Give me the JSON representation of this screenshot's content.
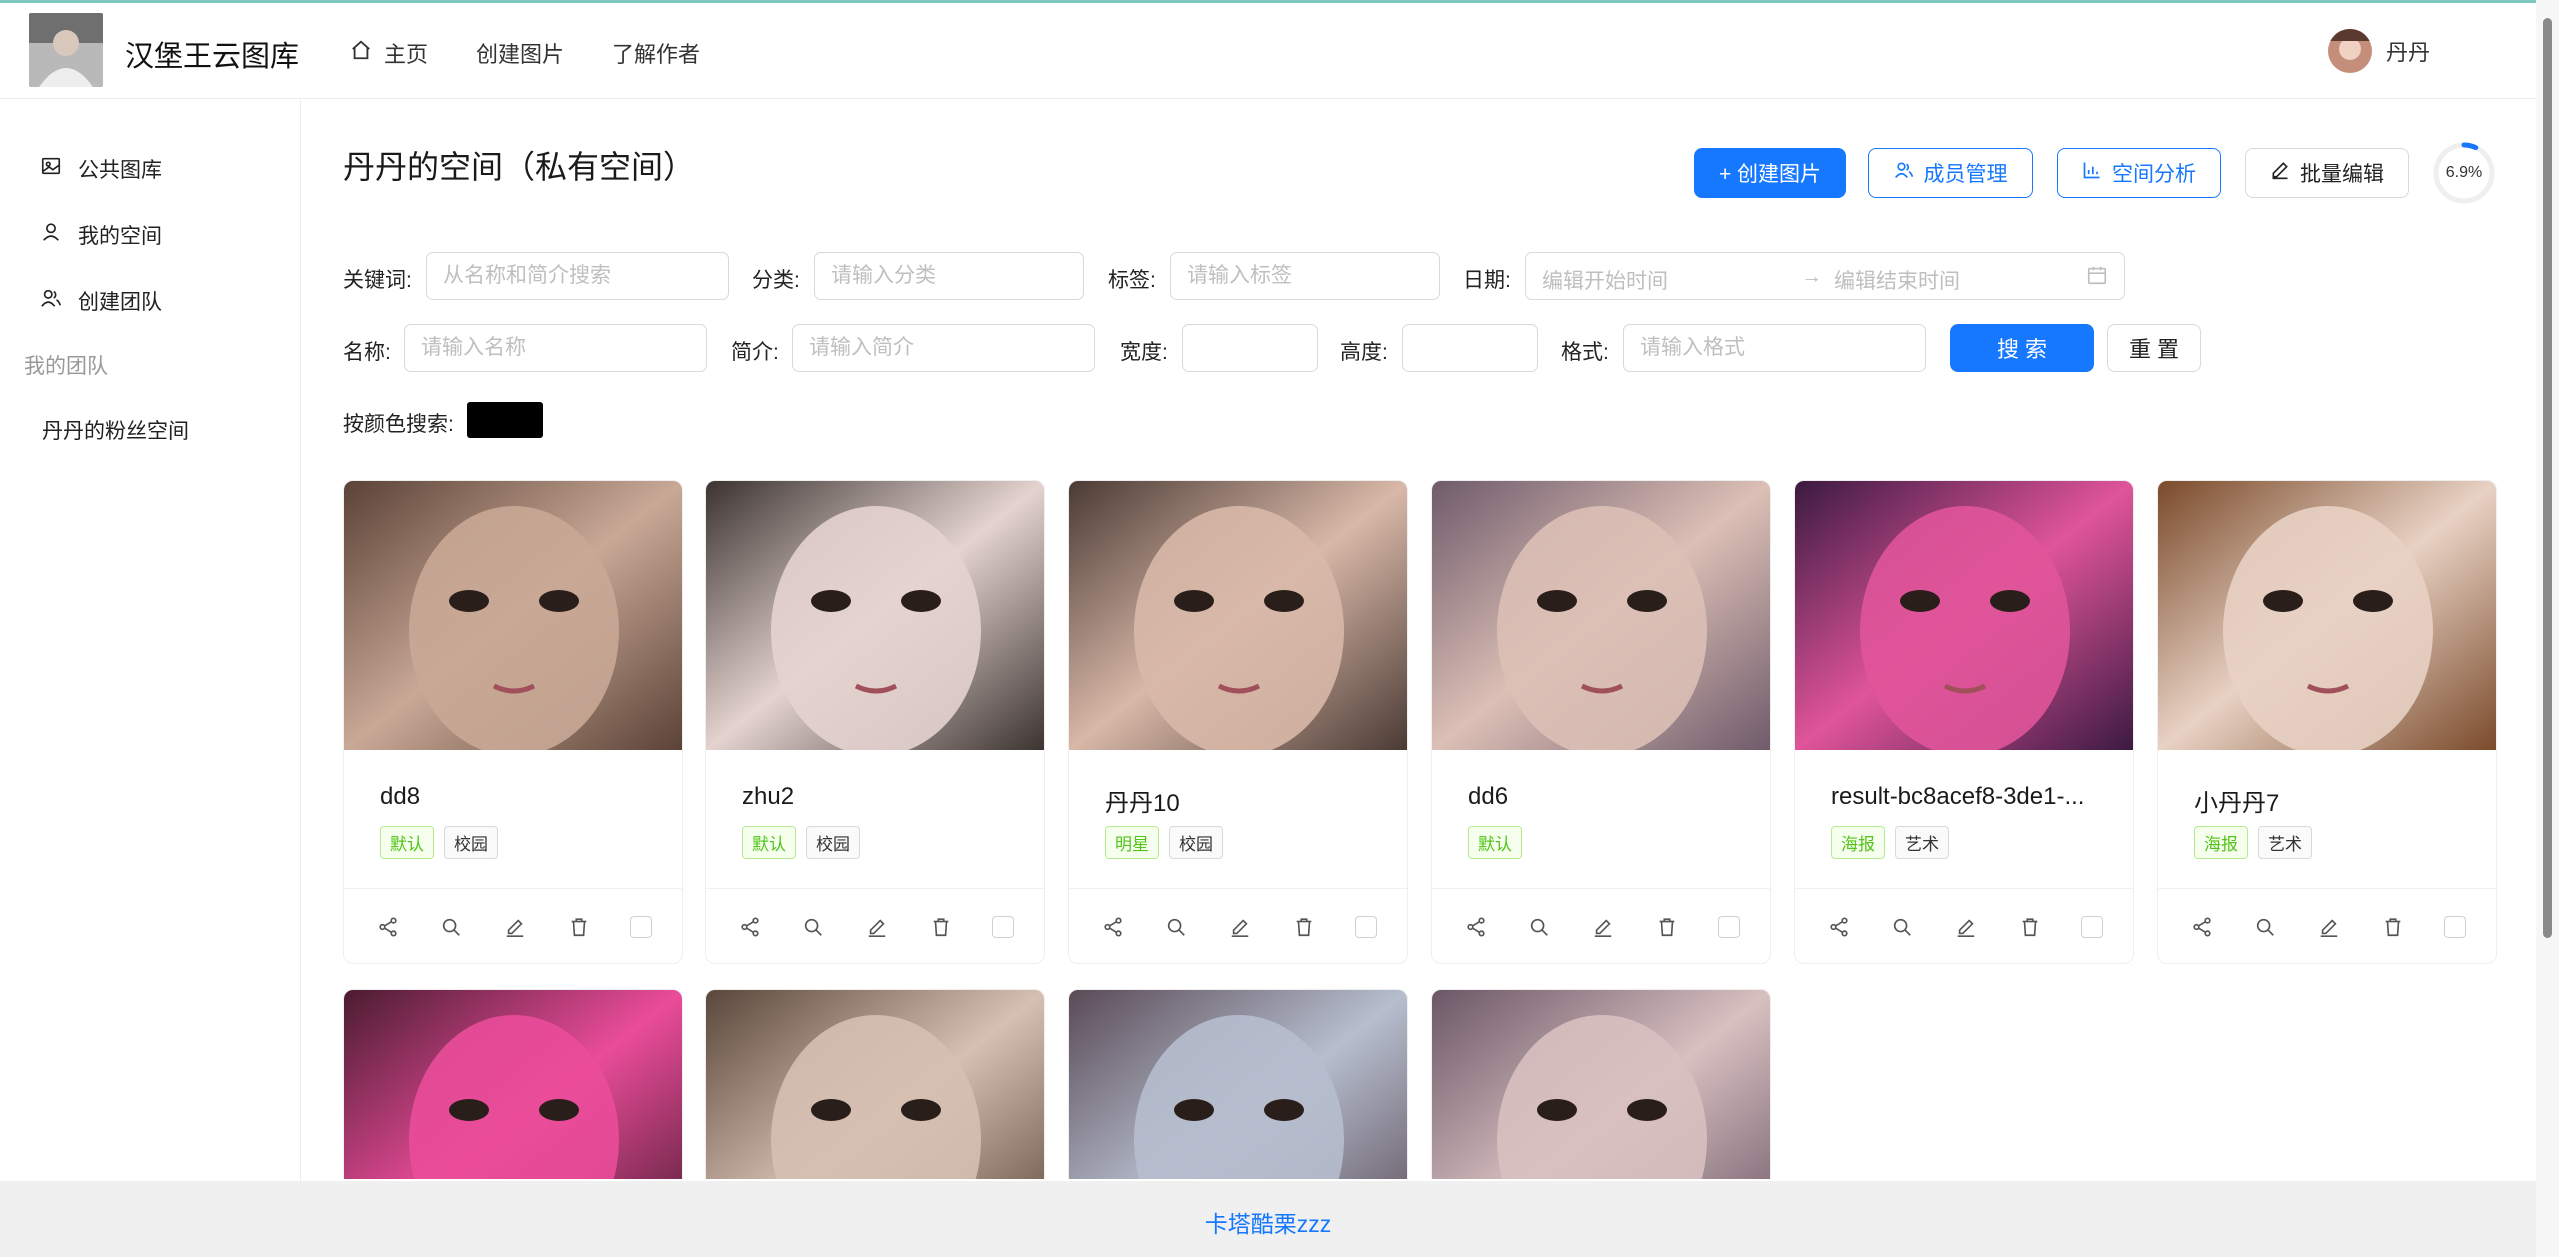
{
  "header": {
    "site_title": "汉堡王云图库",
    "nav": [
      {
        "label": "主页",
        "icon": "home-icon"
      },
      {
        "label": "创建图片"
      },
      {
        "label": "了解作者"
      }
    ],
    "user_name": "丹丹"
  },
  "sidebar": {
    "items": [
      {
        "label": "公共图库",
        "icon": "picture-icon"
      },
      {
        "label": "我的空间",
        "icon": "user-icon"
      },
      {
        "label": "创建团队",
        "icon": "team-icon"
      }
    ],
    "group_title": "我的团队",
    "group_items": [
      {
        "label": "丹丹的粉丝空间"
      }
    ]
  },
  "main": {
    "title": "丹丹的空间（私有空间）",
    "buttons": {
      "create": "+ 创建图片",
      "members": "成员管理",
      "analysis": "空间分析",
      "batch_edit": "批量编辑"
    },
    "usage_percent": "6.9%",
    "usage_fraction": 0.069,
    "filters": {
      "keyword": {
        "label": "关键词:",
        "placeholder": "从名称和简介搜索"
      },
      "category": {
        "label": "分类:",
        "placeholder": "请输入分类"
      },
      "tag": {
        "label": "标签:",
        "placeholder": "请输入标签"
      },
      "date": {
        "label": "日期:",
        "start_placeholder": "编辑开始时间",
        "end_placeholder": "编辑结束时间"
      },
      "name": {
        "label": "名称:",
        "placeholder": "请输入名称"
      },
      "intro": {
        "label": "简介:",
        "placeholder": "请输入简介"
      },
      "width": {
        "label": "宽度:"
      },
      "height": {
        "label": "高度:"
      },
      "format": {
        "label": "格式:",
        "placeholder": "请输入格式"
      },
      "search_button": "搜 索",
      "reset_button": "重 置",
      "color_label": "按颜色搜索:",
      "color_value": "#000000"
    },
    "pictures": [
      {
        "name": "dd8",
        "tags": [
          {
            "text": "默认",
            "style": "green"
          },
          {
            "text": "校园",
            "style": "gray"
          }
        ],
        "tone": [
          "#c9a896",
          "#5a4236"
        ]
      },
      {
        "name": "zhu2",
        "tags": [
          {
            "text": "默认",
            "style": "green"
          },
          {
            "text": "校园",
            "style": "gray"
          }
        ],
        "tone": [
          "#e4d3cf",
          "#3b3330"
        ]
      },
      {
        "name": "丹丹10",
        "tags": [
          {
            "text": "明星",
            "style": "green"
          },
          {
            "text": "校园",
            "style": "gray"
          }
        ],
        "tone": [
          "#d8b8a8",
          "#4a3a34"
        ]
      },
      {
        "name": "dd6",
        "tags": [
          {
            "text": "默认",
            "style": "green"
          }
        ],
        "tone": [
          "#dcc0b6",
          "#6e5a6a"
        ]
      },
      {
        "name": "result-bc8acef8-3de1-...",
        "tags": [
          {
            "text": "海报",
            "style": "green"
          },
          {
            "text": "艺术",
            "style": "gray"
          }
        ],
        "tone": [
          "#e0549a",
          "#3a1a40"
        ]
      },
      {
        "name": "小丹丹7",
        "tags": [
          {
            "text": "海报",
            "style": "green"
          },
          {
            "text": "艺术",
            "style": "gray"
          }
        ],
        "tone": [
          "#e8d2c4",
          "#7a4a2a"
        ]
      },
      {
        "name": "",
        "tags": [],
        "tone": [
          "#ea4c9a",
          "#4a1c30"
        ]
      },
      {
        "name": "",
        "tags": [],
        "tone": [
          "#d6c0b2",
          "#5a463a"
        ]
      },
      {
        "name": "",
        "tags": [],
        "tone": [
          "#b6bece",
          "#5a4a56"
        ]
      },
      {
        "name": "",
        "tags": [],
        "tone": [
          "#d8c0c0",
          "#6a5666"
        ]
      }
    ],
    "card_actions": [
      "share-icon",
      "search-icon",
      "edit-icon",
      "delete-icon",
      "select-checkbox"
    ]
  },
  "footer": {
    "link": "卡塔酷栗zzz"
  },
  "colors": {
    "primary": "#1677ff",
    "tag_green": "#52c41a"
  }
}
